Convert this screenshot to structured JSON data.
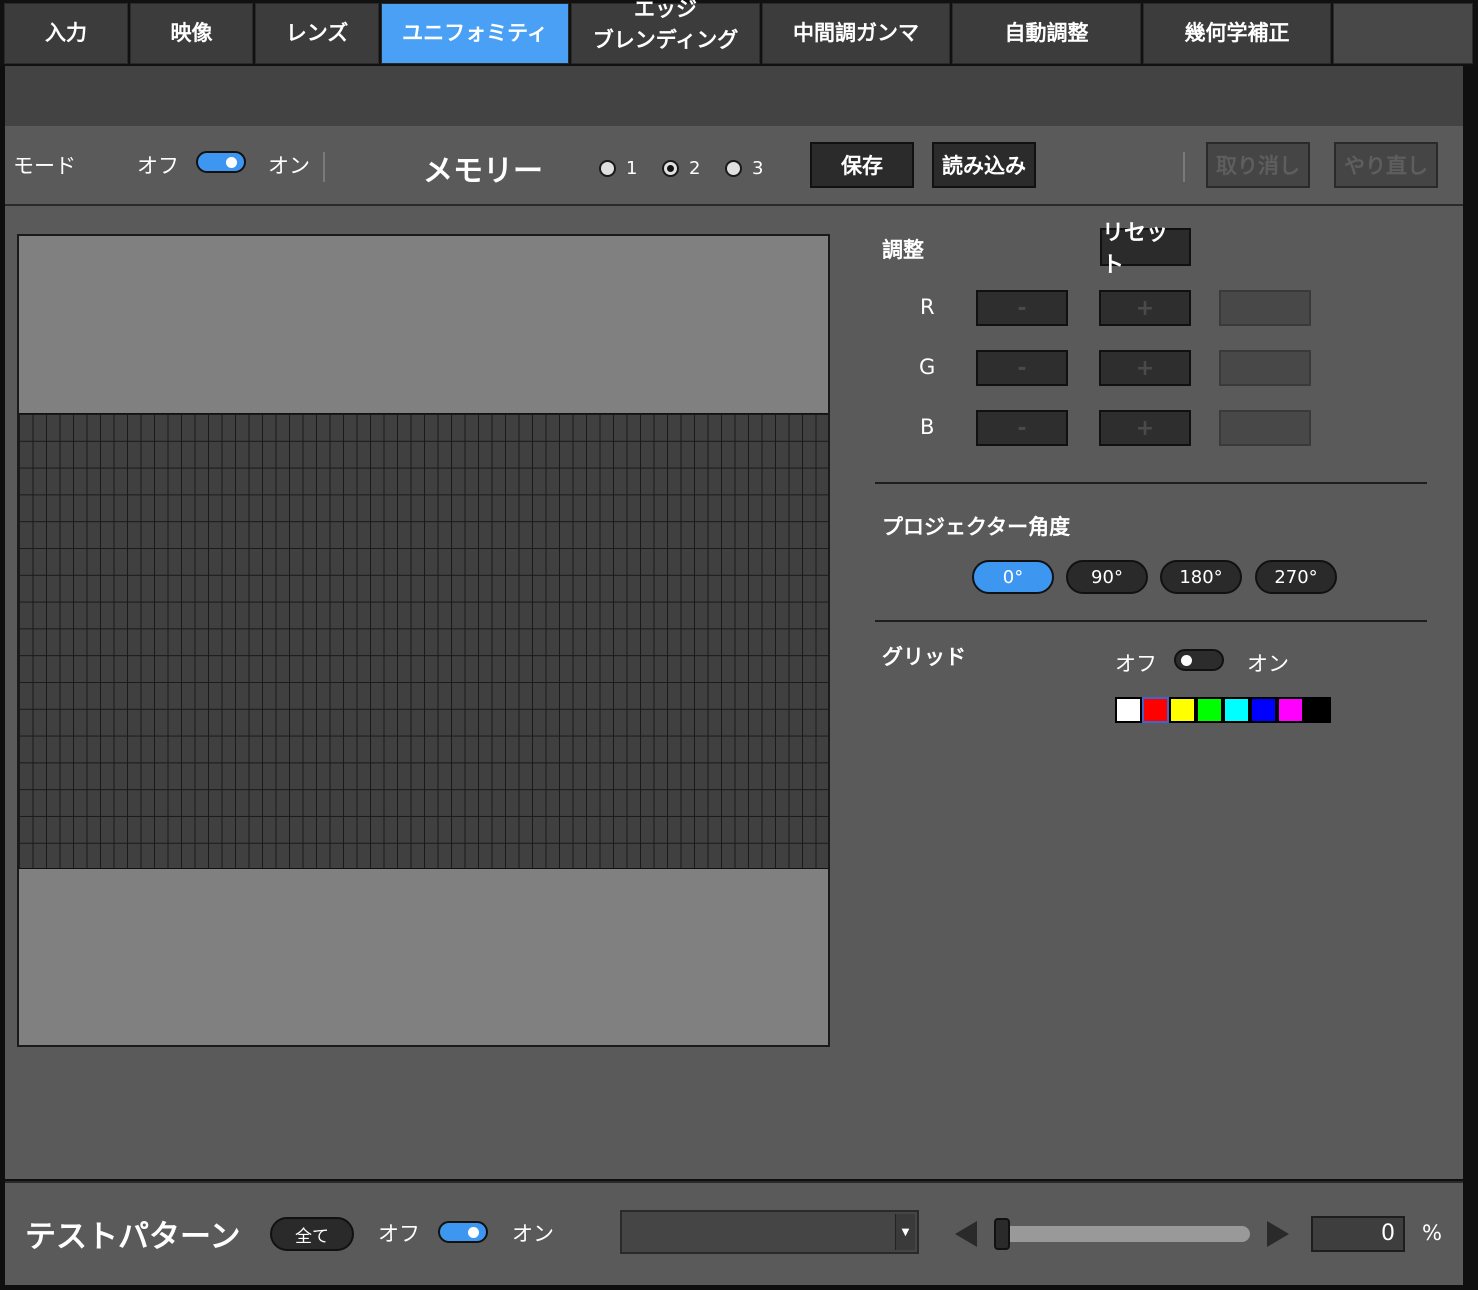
{
  "tabs": [
    {
      "label": "入力"
    },
    {
      "label": "映像"
    },
    {
      "label": "レンズ"
    },
    {
      "label": "ユニフォミティ"
    },
    {
      "label_line1": "エッジ",
      "label_line2": "ブレンディング"
    },
    {
      "label": "中間調ガンマ"
    },
    {
      "label": "自動調整"
    },
    {
      "label": "幾何学補正"
    }
  ],
  "active_tab_index": 3,
  "mode": {
    "label": "モード",
    "off_label": "オフ",
    "on_label": "オン",
    "state": "on"
  },
  "memory": {
    "title": "メモリー",
    "slots": [
      "1",
      "2",
      "3"
    ],
    "selected_slot": "2",
    "save_label": "保存",
    "load_label": "読み込み",
    "undo_label": "取り消し",
    "redo_label": "やり直し"
  },
  "adjust": {
    "title": "調整",
    "reset_label": "リセット",
    "channels": [
      {
        "name": "R"
      },
      {
        "name": "G"
      },
      {
        "name": "B"
      }
    ],
    "minus_label": "-",
    "plus_label": "+"
  },
  "angle": {
    "title": "プロジェクター角度",
    "options": [
      "0°",
      "90°",
      "180°",
      "270°"
    ],
    "selected": "0°"
  },
  "grid": {
    "title": "グリッド",
    "off_label": "オフ",
    "on_label": "オン",
    "state": "off",
    "colors": [
      "#ffffff",
      "#ff0000",
      "#ffff00",
      "#00ff00",
      "#00ffff",
      "#0000ff",
      "#ff00ff",
      "#000000"
    ],
    "selected_color": "#ff0000"
  },
  "test_pattern": {
    "title": "テストパターン",
    "all_label": "全て",
    "off_label": "オフ",
    "on_label": "オン",
    "state": "on",
    "dropdown_value": "",
    "level_value": "0",
    "unit": "%"
  },
  "colors": {
    "accent": "#4aa0f5",
    "panel": "#5a5a5a",
    "tab": "#3c3c3c"
  }
}
